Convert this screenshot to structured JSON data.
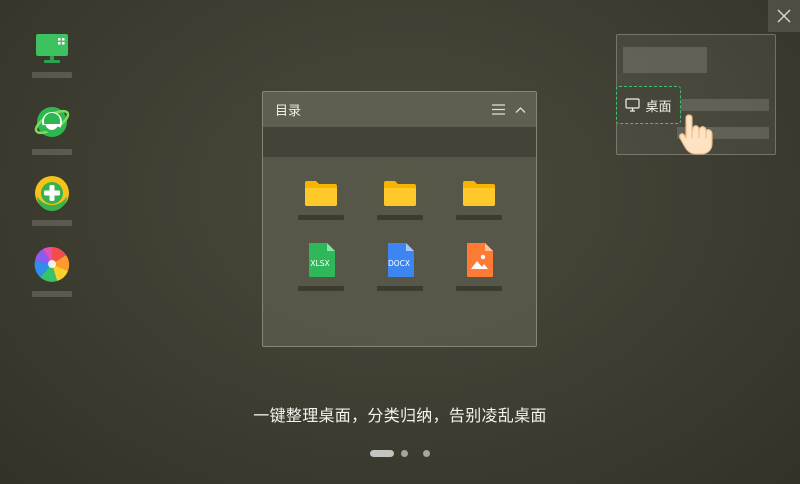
{
  "window": {
    "close_icon": "close-icon"
  },
  "desktop_icons": [
    {
      "name": "computer-manager-icon"
    },
    {
      "name": "browser-e-icon"
    },
    {
      "name": "security-plus-icon"
    },
    {
      "name": "pinwheel-app-icon"
    }
  ],
  "fence": {
    "title": "目录",
    "menu_icon": "menu-icon",
    "collapse_icon": "chevron-up-icon",
    "files": [
      {
        "type": "folder",
        "label": ""
      },
      {
        "type": "folder",
        "label": ""
      },
      {
        "type": "folder",
        "label": ""
      },
      {
        "type": "xlsx",
        "label": "XLSX"
      },
      {
        "type": "docx",
        "label": "DOCX"
      },
      {
        "type": "image",
        "label": ""
      }
    ]
  },
  "preview": {
    "desktop_chip_label": "桌面",
    "monitor_icon": "monitor-icon",
    "hand_icon": "hand-pointer-icon",
    "accent_color": "#3fc36b"
  },
  "caption": "一键整理桌面，分类归纳，告别凌乱桌面",
  "pager": {
    "total": 3,
    "active": 1
  }
}
